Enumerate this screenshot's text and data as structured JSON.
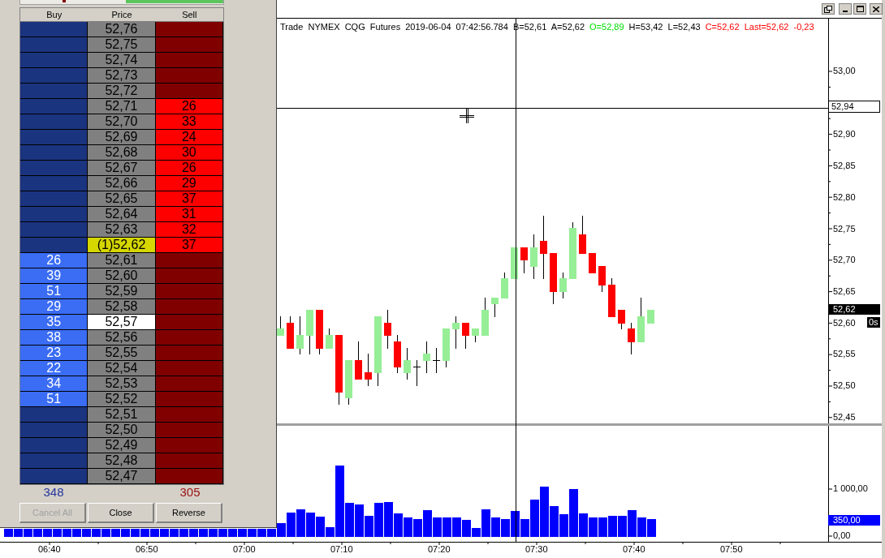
{
  "chart_window": {
    "header": [
      {
        "text": "Trade  NYMEX  CQG  Futures  2019-06-04  07:42:56.784  B=52,61  A=52,62",
        "color": "#000000"
      },
      {
        "text": "O=52,89",
        "color": "#00dd00"
      },
      {
        "text": "H=53,42  L=52,43",
        "color": "#000000"
      },
      {
        "text": "C=52,62  Last=52,62  -0,23",
        "color": "#ff0000"
      }
    ],
    "price_axis": {
      "labels": [
        "53,00",
        "52,90",
        "52,85",
        "52,80",
        "52,75",
        "52,70",
        "52,65",
        "52,60",
        "52,55",
        "52,50",
        "52,45"
      ],
      "crosshair_price": "52,94",
      "last_price": "52,62",
      "timer": "0s"
    },
    "volume_axis": {
      "labels": [
        "1 000,00",
        "0,00"
      ],
      "last_volume": "350,00"
    },
    "time_axis": [
      "06:40",
      "06:50",
      "07:00",
      "07:10",
      "07:20",
      "07:30",
      "07:40",
      "07:50"
    ]
  },
  "dom_window": {
    "columns": [
      "Buy",
      "Price",
      "Sell"
    ],
    "rows": [
      {
        "price": "52,76",
        "position": false,
        "current": false
      },
      {
        "price": "52,75",
        "position": false,
        "current": false
      },
      {
        "price": "52,74",
        "position": false,
        "current": false
      },
      {
        "price": "52,73",
        "position": false,
        "current": false
      },
      {
        "price": "52,72",
        "position": false,
        "current": false
      },
      {
        "price": "52,71",
        "position": false,
        "current": false,
        "sell": "26"
      },
      {
        "price": "52,70",
        "position": false,
        "current": false,
        "sell": "33"
      },
      {
        "price": "52,69",
        "position": false,
        "current": false,
        "sell": "24"
      },
      {
        "price": "52,68",
        "position": false,
        "current": false,
        "sell": "30"
      },
      {
        "price": "52,67",
        "position": false,
        "current": false,
        "sell": "26"
      },
      {
        "price": "52,66",
        "position": false,
        "current": false,
        "sell": "29"
      },
      {
        "price": "52,65",
        "position": false,
        "current": false,
        "sell": "37"
      },
      {
        "price": "52,64",
        "position": false,
        "current": false,
        "sell": "31"
      },
      {
        "price": "52,63",
        "position": false,
        "current": false,
        "sell": "32"
      },
      {
        "price": "(1)52,62",
        "position": true,
        "current": false,
        "sell": "37"
      },
      {
        "price": "52,61",
        "position": false,
        "current": false,
        "buy": "26"
      },
      {
        "price": "52,60",
        "position": false,
        "current": false,
        "buy": "39"
      },
      {
        "price": "52,59",
        "position": false,
        "current": false,
        "buy": "51"
      },
      {
        "price": "52,58",
        "position": false,
        "current": false,
        "buy": "29"
      },
      {
        "price": "52,57",
        "position": false,
        "current": true,
        "buy": "35"
      },
      {
        "price": "52,56",
        "position": false,
        "current": false,
        "buy": "38"
      },
      {
        "price": "52,55",
        "position": false,
        "current": false,
        "buy": "23"
      },
      {
        "price": "52,54",
        "position": false,
        "current": false,
        "buy": "22"
      },
      {
        "price": "52,53",
        "position": false,
        "current": false,
        "buy": "34"
      },
      {
        "price": "52,52",
        "position": false,
        "current": false,
        "buy": "51"
      },
      {
        "price": "52,51",
        "position": false,
        "current": false
      },
      {
        "price": "52,50",
        "position": false,
        "current": false
      },
      {
        "price": "52,49",
        "position": false,
        "current": false
      },
      {
        "price": "52,48",
        "position": false,
        "current": false
      },
      {
        "price": "52,47",
        "position": false,
        "current": false
      }
    ],
    "buy_total": "348",
    "sell_total": "305",
    "buttons": [
      {
        "label": "Cancel All",
        "disabled": true
      },
      {
        "label": "Close",
        "disabled": false
      },
      {
        "label": "Reverse",
        "disabled": false
      }
    ]
  }
}
